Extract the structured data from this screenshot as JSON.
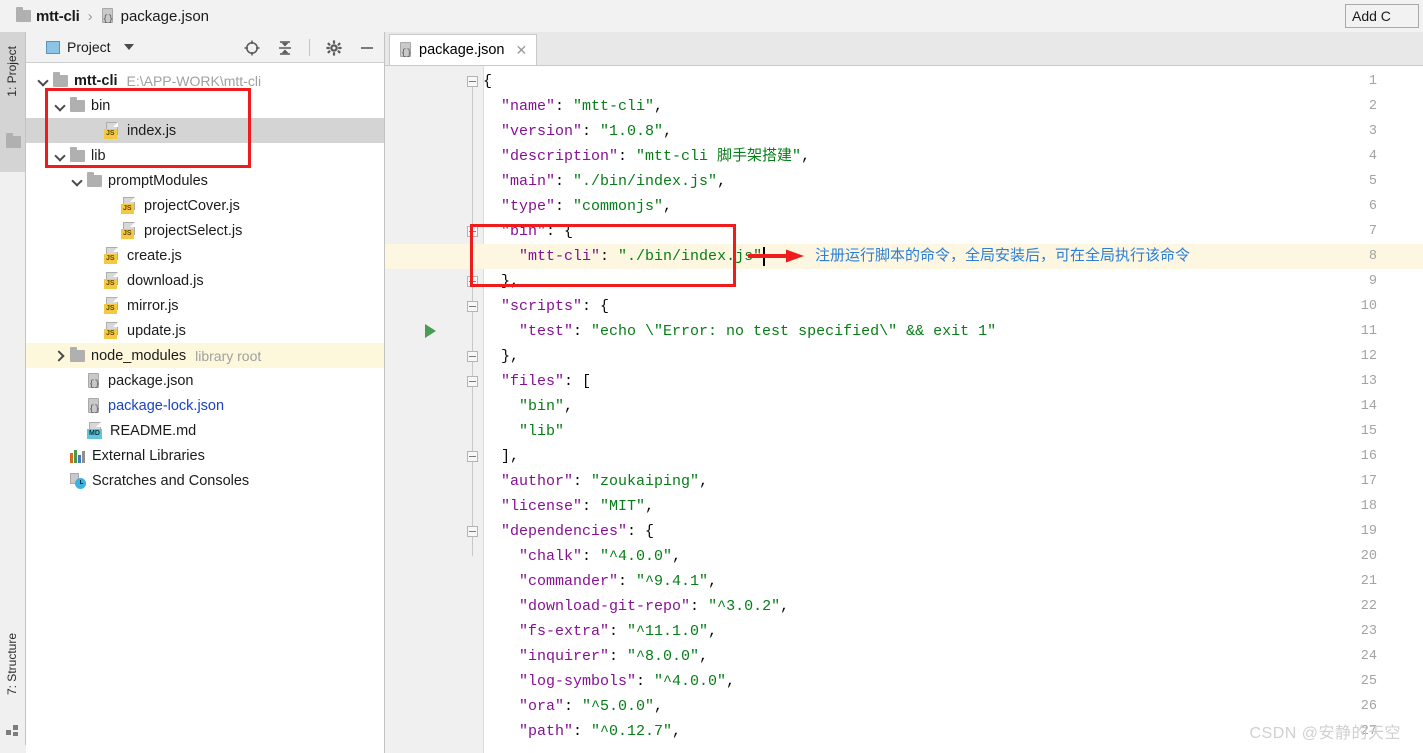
{
  "breadcrumb": {
    "project": "mtt-cli",
    "separator": "›",
    "file": "package.json",
    "folder_icon": "folder-icon",
    "json_icon": "json-file-icon"
  },
  "toolbar": {
    "add_configuration_label": "Add C"
  },
  "left_strips": {
    "project_label": "1: Project",
    "structure_label": "7: Structure"
  },
  "project_panel": {
    "title": "Project",
    "dropdown_icon": "chevron-down-icon",
    "toolbar_icons": [
      {
        "name": "locate-target-icon",
        "title": "Select Opened File"
      },
      {
        "name": "collapse-all-icon",
        "title": "Collapse All"
      },
      {
        "name": "gear-icon",
        "title": "Settings"
      },
      {
        "name": "minimize-icon",
        "title": "Hide"
      }
    ],
    "tree": [
      {
        "label": "mtt-cli",
        "sub": "E:\\APP-WORK\\mtt-cli",
        "indent": 0,
        "arrow": "open",
        "icon": "folder-icon",
        "bold": true,
        "selected": false,
        "blue": false
      },
      {
        "label": "bin",
        "sub": "",
        "indent": 1,
        "arrow": "open",
        "icon": "folder-icon",
        "bold": false,
        "selected": false,
        "blue": false
      },
      {
        "label": "index.js",
        "sub": "",
        "indent": 3,
        "arrow": "none",
        "icon": "js-file-icon",
        "bold": false,
        "selected": true,
        "blue": false
      },
      {
        "label": "lib",
        "sub": "",
        "indent": 1,
        "arrow": "open",
        "icon": "folder-icon",
        "bold": false,
        "selected": false,
        "blue": false
      },
      {
        "label": "promptModules",
        "sub": "",
        "indent": 2,
        "arrow": "open",
        "icon": "folder-icon",
        "bold": false,
        "selected": false,
        "blue": false
      },
      {
        "label": "projectCover.js",
        "sub": "",
        "indent": 4,
        "arrow": "none",
        "icon": "js-file-icon",
        "bold": false,
        "selected": false,
        "blue": false
      },
      {
        "label": "projectSelect.js",
        "sub": "",
        "indent": 4,
        "arrow": "none",
        "icon": "js-file-icon",
        "bold": false,
        "selected": false,
        "blue": false
      },
      {
        "label": "create.js",
        "sub": "",
        "indent": 3,
        "arrow": "none",
        "icon": "js-file-icon",
        "bold": false,
        "selected": false,
        "blue": false
      },
      {
        "label": "download.js",
        "sub": "",
        "indent": 3,
        "arrow": "none",
        "icon": "js-file-icon",
        "bold": false,
        "selected": false,
        "blue": false
      },
      {
        "label": "mirror.js",
        "sub": "",
        "indent": 3,
        "arrow": "none",
        "icon": "js-file-icon",
        "bold": false,
        "selected": false,
        "blue": false
      },
      {
        "label": "update.js",
        "sub": "",
        "indent": 3,
        "arrow": "none",
        "icon": "js-file-icon",
        "bold": false,
        "selected": false,
        "blue": false
      },
      {
        "label": "node_modules",
        "sub": "library root",
        "indent": 1,
        "arrow": "closed",
        "icon": "folder-icon",
        "bold": false,
        "selected": false,
        "blue": false,
        "library_root": true
      },
      {
        "label": "package.json",
        "sub": "",
        "indent": 2,
        "arrow": "none",
        "icon": "json-file-icon",
        "bold": false,
        "selected": false,
        "blue": false
      },
      {
        "label": "package-lock.json",
        "sub": "",
        "indent": 2,
        "arrow": "none",
        "icon": "json-file-icon",
        "bold": false,
        "selected": false,
        "blue": true
      },
      {
        "label": "README.md",
        "sub": "",
        "indent": 2,
        "arrow": "none",
        "icon": "md-file-icon",
        "bold": false,
        "selected": false,
        "blue": false
      },
      {
        "label": "External Libraries",
        "sub": "",
        "indent": 1,
        "arrow": "none",
        "icon": "libraries-icon",
        "bold": false,
        "selected": false,
        "blue": false
      },
      {
        "label": "Scratches and Consoles",
        "sub": "",
        "indent": 1,
        "arrow": "none",
        "icon": "scratches-icon",
        "bold": false,
        "selected": false,
        "blue": false
      }
    ]
  },
  "editor": {
    "tab": {
      "label": "package.json",
      "icon": "json-file-icon",
      "close_icon": "close-icon"
    },
    "caret_line": 8,
    "run_marker_line": 11,
    "fold_lines": [
      1,
      7,
      9,
      10,
      12,
      13,
      16,
      19
    ],
    "lines": [
      {
        "n": 1,
        "segments": [
          {
            "t": "{",
            "c": "p"
          }
        ]
      },
      {
        "n": 2,
        "segments": [
          {
            "t": "  \"name\"",
            "c": "k"
          },
          {
            "t": ": ",
            "c": "p"
          },
          {
            "t": "\"mtt-cli\"",
            "c": "s"
          },
          {
            "t": ",",
            "c": "p"
          }
        ]
      },
      {
        "n": 3,
        "segments": [
          {
            "t": "  \"version\"",
            "c": "k"
          },
          {
            "t": ": ",
            "c": "p"
          },
          {
            "t": "\"1.0.8\"",
            "c": "s"
          },
          {
            "t": ",",
            "c": "p"
          }
        ]
      },
      {
        "n": 4,
        "segments": [
          {
            "t": "  \"description\"",
            "c": "k"
          },
          {
            "t": ": ",
            "c": "p"
          },
          {
            "t": "\"mtt-cli 脚手架搭建\"",
            "c": "s"
          },
          {
            "t": ",",
            "c": "p"
          }
        ]
      },
      {
        "n": 5,
        "segments": [
          {
            "t": "  \"main\"",
            "c": "k"
          },
          {
            "t": ": ",
            "c": "p"
          },
          {
            "t": "\"./bin/index.js\"",
            "c": "s"
          },
          {
            "t": ",",
            "c": "p"
          }
        ]
      },
      {
        "n": 6,
        "segments": [
          {
            "t": "  \"type\"",
            "c": "k"
          },
          {
            "t": ": ",
            "c": "p"
          },
          {
            "t": "\"commonjs\"",
            "c": "s"
          },
          {
            "t": ",",
            "c": "p"
          }
        ]
      },
      {
        "n": 7,
        "segments": [
          {
            "t": "  \"bin\"",
            "c": "k"
          },
          {
            "t": ": {",
            "c": "p"
          }
        ]
      },
      {
        "n": 8,
        "segments": [
          {
            "t": "    \"mtt-cli\"",
            "c": "k"
          },
          {
            "t": ": ",
            "c": "p"
          },
          {
            "t": "\"./bin/index.js\"",
            "c": "s"
          }
        ]
      },
      {
        "n": 9,
        "segments": [
          {
            "t": "  },",
            "c": "p"
          }
        ]
      },
      {
        "n": 10,
        "segments": [
          {
            "t": "  \"scripts\"",
            "c": "k"
          },
          {
            "t": ": {",
            "c": "p"
          }
        ]
      },
      {
        "n": 11,
        "segments": [
          {
            "t": "    \"test\"",
            "c": "k"
          },
          {
            "t": ": ",
            "c": "p"
          },
          {
            "t": "\"echo \\\"Error: no test specified\\\" && exit 1\"",
            "c": "s"
          }
        ]
      },
      {
        "n": 12,
        "segments": [
          {
            "t": "  },",
            "c": "p"
          }
        ]
      },
      {
        "n": 13,
        "segments": [
          {
            "t": "  \"files\"",
            "c": "k"
          },
          {
            "t": ": [",
            "c": "p"
          }
        ]
      },
      {
        "n": 14,
        "segments": [
          {
            "t": "    \"bin\"",
            "c": "s"
          },
          {
            "t": ",",
            "c": "p"
          }
        ]
      },
      {
        "n": 15,
        "segments": [
          {
            "t": "    \"lib\"",
            "c": "s"
          }
        ]
      },
      {
        "n": 16,
        "segments": [
          {
            "t": "  ],",
            "c": "p"
          }
        ]
      },
      {
        "n": 17,
        "segments": [
          {
            "t": "  \"author\"",
            "c": "k"
          },
          {
            "t": ": ",
            "c": "p"
          },
          {
            "t": "\"zoukaiping\"",
            "c": "s"
          },
          {
            "t": ",",
            "c": "p"
          }
        ]
      },
      {
        "n": 18,
        "segments": [
          {
            "t": "  \"license\"",
            "c": "k"
          },
          {
            "t": ": ",
            "c": "p"
          },
          {
            "t": "\"MIT\"",
            "c": "s"
          },
          {
            "t": ",",
            "c": "p"
          }
        ]
      },
      {
        "n": 19,
        "segments": [
          {
            "t": "  \"dependencies\"",
            "c": "k"
          },
          {
            "t": ": {",
            "c": "p"
          }
        ]
      },
      {
        "n": 20,
        "segments": [
          {
            "t": "    \"chalk\"",
            "c": "k"
          },
          {
            "t": ": ",
            "c": "p"
          },
          {
            "t": "\"^4.0.0\"",
            "c": "s"
          },
          {
            "t": ",",
            "c": "p"
          }
        ]
      },
      {
        "n": 21,
        "segments": [
          {
            "t": "    \"commander\"",
            "c": "k"
          },
          {
            "t": ": ",
            "c": "p"
          },
          {
            "t": "\"^9.4.1\"",
            "c": "s"
          },
          {
            "t": ",",
            "c": "p"
          }
        ]
      },
      {
        "n": 22,
        "segments": [
          {
            "t": "    \"download-git-repo\"",
            "c": "k"
          },
          {
            "t": ": ",
            "c": "p"
          },
          {
            "t": "\"^3.0.2\"",
            "c": "s"
          },
          {
            "t": ",",
            "c": "p"
          }
        ]
      },
      {
        "n": 23,
        "segments": [
          {
            "t": "    \"fs-extra\"",
            "c": "k"
          },
          {
            "t": ": ",
            "c": "p"
          },
          {
            "t": "\"^11.1.0\"",
            "c": "s"
          },
          {
            "t": ",",
            "c": "p"
          }
        ]
      },
      {
        "n": 24,
        "segments": [
          {
            "t": "    \"inquirer\"",
            "c": "k"
          },
          {
            "t": ": ",
            "c": "p"
          },
          {
            "t": "\"^8.0.0\"",
            "c": "s"
          },
          {
            "t": ",",
            "c": "p"
          }
        ]
      },
      {
        "n": 25,
        "segments": [
          {
            "t": "    \"log-symbols\"",
            "c": "k"
          },
          {
            "t": ": ",
            "c": "p"
          },
          {
            "t": "\"^4.0.0\"",
            "c": "s"
          },
          {
            "t": ",",
            "c": "p"
          }
        ]
      },
      {
        "n": 26,
        "segments": [
          {
            "t": "    \"ora\"",
            "c": "k"
          },
          {
            "t": ": ",
            "c": "p"
          },
          {
            "t": "\"^5.0.0\"",
            "c": "s"
          },
          {
            "t": ",",
            "c": "p"
          }
        ]
      },
      {
        "n": 27,
        "segments": [
          {
            "t": "    \"path\"",
            "c": "k"
          },
          {
            "t": ": ",
            "c": "p"
          },
          {
            "t": "\"^0.12.7\"",
            "c": "s"
          },
          {
            "t": ",",
            "c": "p"
          }
        ]
      }
    ]
  },
  "annotation": {
    "arrow_icon": "right-arrow-icon",
    "text": "注册运行脚本的命令，全局安装后，可在全局执行该命令",
    "color": "#2b7fd4",
    "box_color": "#ee1c1c"
  },
  "watermark": {
    "text": "CSDN @安静的天空"
  }
}
